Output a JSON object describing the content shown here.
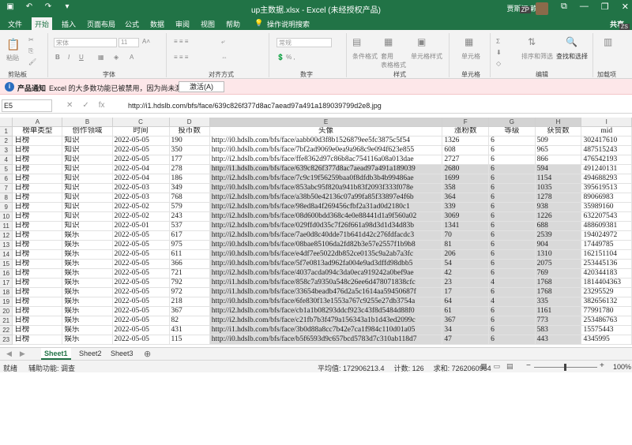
{
  "titlebar": {
    "title": "up主数据.xlsx  -  Excel (未经授权产品)",
    "user": "贾斯汀 赖",
    "user_keytip": "ZP",
    "minimize": "—",
    "restore": "❐",
    "close": "✕"
  },
  "ribbon_tabs": [
    {
      "label": "文件",
      "keytip": "F"
    },
    {
      "label": "开始",
      "keytip": "H"
    },
    {
      "label": "插入",
      "keytip": "N"
    },
    {
      "label": "页面布局",
      "keytip": "P"
    },
    {
      "label": "公式",
      "keytip": "M"
    },
    {
      "label": "数据",
      "keytip": "A"
    },
    {
      "label": "审阅",
      "keytip": "R"
    },
    {
      "label": "视图",
      "keytip": "W"
    },
    {
      "label": "帮助",
      "keytip": "Y"
    },
    {
      "label": "操作说明搜索",
      "keytip": "Q"
    }
  ],
  "share": {
    "label": "共享",
    "keytip": "ZS"
  },
  "ribbon": {
    "paste": "粘贴",
    "font_name": "宋体",
    "font_size": "11",
    "number_format": "常规",
    "cond_format": "条件格式",
    "table_format": "套用\n表格格式",
    "cell_style": "单元格样式",
    "cells": "单元格",
    "sort_filter": "排序和筛选",
    "find_select": "查找和选择",
    "groups": [
      "剪贴板",
      "字体",
      "对齐方式",
      "数字",
      "样式",
      "单元格",
      "编辑",
      "加载项"
    ]
  },
  "notification": {
    "title": "产品通知",
    "message": "Excel 的大多数功能已被禁用，因为尚未激活。",
    "button": "激活(A)"
  },
  "formula_bar": {
    "name_box": "E5",
    "formula": "http://i1.hdslb.com/bfs/face/639c826f377d8ac7aead97a491a189039799d2e8.jpg"
  },
  "sheet": {
    "columns": [
      "A",
      "B",
      "C",
      "D",
      "E",
      "F",
      "G",
      "H",
      "I"
    ],
    "header": [
      "榜单类型",
      "创作领域",
      "时间",
      "投币数",
      "头像",
      "涨粉数",
      "等级",
      "获赞数",
      "mid"
    ],
    "rows": [
      [
        "2",
        "日榜",
        "知识",
        "2022-05-05",
        "190",
        "http://i0.hdslb.com/bfs/face/aabb00d3f8b1526879ee5fc3875c5f54",
        "1326",
        "6",
        "509",
        "302417610"
      ],
      [
        "3",
        "日榜",
        "知识",
        "2022-05-05",
        "350",
        "http://i0.hdslb.com/bfs/face/7bf2ad9069e0ea9a968c9e094f623e855",
        "608",
        "6",
        "965",
        "487515243"
      ],
      [
        "4",
        "日榜",
        "知识",
        "2022-05-05",
        "177",
        "http://i2.hdslb.com/bfs/face/ffe8362d97c86b8ac754116a08a013dae",
        "2727",
        "6",
        "866",
        "476542193"
      ],
      [
        "5",
        "日榜",
        "知识",
        "2022-05-04",
        "278",
        "http://i1.hdslb.com/bfs/face/639c826f377d8ac7aead97a491a189039",
        "2680",
        "6",
        "594",
        "491240131"
      ],
      [
        "6",
        "日榜",
        "知识",
        "2022-05-04",
        "186",
        "http://i2.hdslb.com/bfs/face/7c9c19f56259baa0f8dfdb3b4b99486ae",
        "1699",
        "6",
        "1154",
        "494688293"
      ],
      [
        "7",
        "日榜",
        "知识",
        "2022-05-03",
        "349",
        "http://i0.hdslb.com/bfs/face/853abc95f820a941b83f2093f333f078e",
        "358",
        "6",
        "1035",
        "395619513"
      ],
      [
        "8",
        "日榜",
        "知识",
        "2022-05-03",
        "768",
        "http://i2.hdslb.com/bfs/face/a38b50e42136c07a99fa85f33897e4f6b",
        "364",
        "6",
        "1278",
        "89066983"
      ],
      [
        "9",
        "日榜",
        "知识",
        "2022-05-02",
        "579",
        "http://i2.hdslb.com/bfs/face/98ed8a4f269456cfbf2a31ad0d2180c1",
        "339",
        "6",
        "938",
        "35989160"
      ],
      [
        "10",
        "日榜",
        "知识",
        "2022-05-02",
        "243",
        "http://i2.hdslb.com/bfs/face/08d600bdd368c4e0e88441d1a9f560a02",
        "3069",
        "6",
        "1226",
        "632207543"
      ],
      [
        "11",
        "日榜",
        "知识",
        "2022-05-01",
        "537",
        "http://i2.hdslb.com/bfs/face/029ffd0d35c7f26f661a98d3d1d34d83b",
        "1341",
        "6",
        "688",
        "488609381"
      ],
      [
        "12",
        "日榜",
        "娱乐",
        "2022-05-05",
        "617",
        "http://i2.hdslb.com/bfs/face/7ae0d8c40dde71b641d42c276fdfacdc3",
        "70",
        "6",
        "2539",
        "194024972"
      ],
      [
        "13",
        "日榜",
        "娱乐",
        "2022-05-05",
        "975",
        "http://i0.hdslb.com/bfs/face/08bae85106da2fd82b3e57e2557f1b9b8",
        "81",
        "6",
        "904",
        "17449785"
      ],
      [
        "14",
        "日榜",
        "娱乐",
        "2022-05-05",
        "611",
        "http://i0.hdslb.com/bfs/face/e4df7ee5022db852ce0135c9a2ab7a3fc",
        "206",
        "6",
        "1310",
        "162151104"
      ],
      [
        "15",
        "日榜",
        "娱乐",
        "2022-05-05",
        "366",
        "http://i0.hdslb.com/bfs/face/5f7e0813ad962fa004e9ad3dffd98dbb5",
        "54",
        "6",
        "2075",
        "253445136"
      ],
      [
        "16",
        "日榜",
        "娱乐",
        "2022-05-05",
        "721",
        "http://i2.hdslb.com/bfs/face/4037acda094c3da0eca919242a0bef9ae",
        "42",
        "6",
        "769",
        "420344183"
      ],
      [
        "17",
        "日榜",
        "娱乐",
        "2022-05-05",
        "792",
        "http://i1.hdslb.com/bfs/face/858c7a9350a548c26ee6d478071838cfc",
        "23",
        "4",
        "1768",
        "1814404363"
      ],
      [
        "18",
        "日榜",
        "娱乐",
        "2022-05-05",
        "972",
        "http://i1.hdslb.com/bfs/face/33654beadb476d2a5c1614aa59450687f",
        "17",
        "6",
        "1768",
        "23295529"
      ],
      [
        "19",
        "日榜",
        "娱乐",
        "2022-05-05",
        "218",
        "http://i0.hdslb.com/bfs/face/6fe830f13e1553a767c9255e27db3754a",
        "64",
        "4",
        "335",
        "382656132"
      ],
      [
        "20",
        "日榜",
        "娱乐",
        "2022-05-05",
        "367",
        "http://i2.hdslb.com/bfs/face/cb1a1b08293ddcf923c43f8d5484d88f0",
        "61",
        "6",
        "1161",
        "77991780"
      ],
      [
        "21",
        "日榜",
        "娱乐",
        "2022-05-05",
        "82",
        "http://i2.hdslb.com/bfs/face/c21fb7b3f479a156343a1b1d43ed2099c",
        "367",
        "6",
        "773",
        "253486763"
      ],
      [
        "22",
        "日榜",
        "娱乐",
        "2022-05-05",
        "431",
        "http://i1.hdslb.com/bfs/face/3b0d88a8cc7b42e7ca1f984c110d01a05",
        "34",
        "6",
        "583",
        "15575443"
      ],
      [
        "23",
        "日榜",
        "娱乐",
        "2022-05-05",
        "115",
        "http://i0.hdslb.com/bfs/face/b5f6593d9c657bcd5783d7c310ab118d7",
        "47",
        "6",
        "443",
        "4345995"
      ]
    ]
  },
  "sheet_tabs": [
    "Sheet1",
    "Sheet2",
    "Sheet3"
  ],
  "status": {
    "mode": "就绪",
    "accessibility": "辅助功能: 调查",
    "average": "平均值: 172906213.4",
    "count": "计数: 126",
    "sum": "求和: 7262060964",
    "zoom_level": "100%",
    "zoom_value": 100
  },
  "colors": {
    "excel_green": "#217346",
    "notification_bg": "#fde7e9",
    "selection": "#d9d9d9"
  }
}
